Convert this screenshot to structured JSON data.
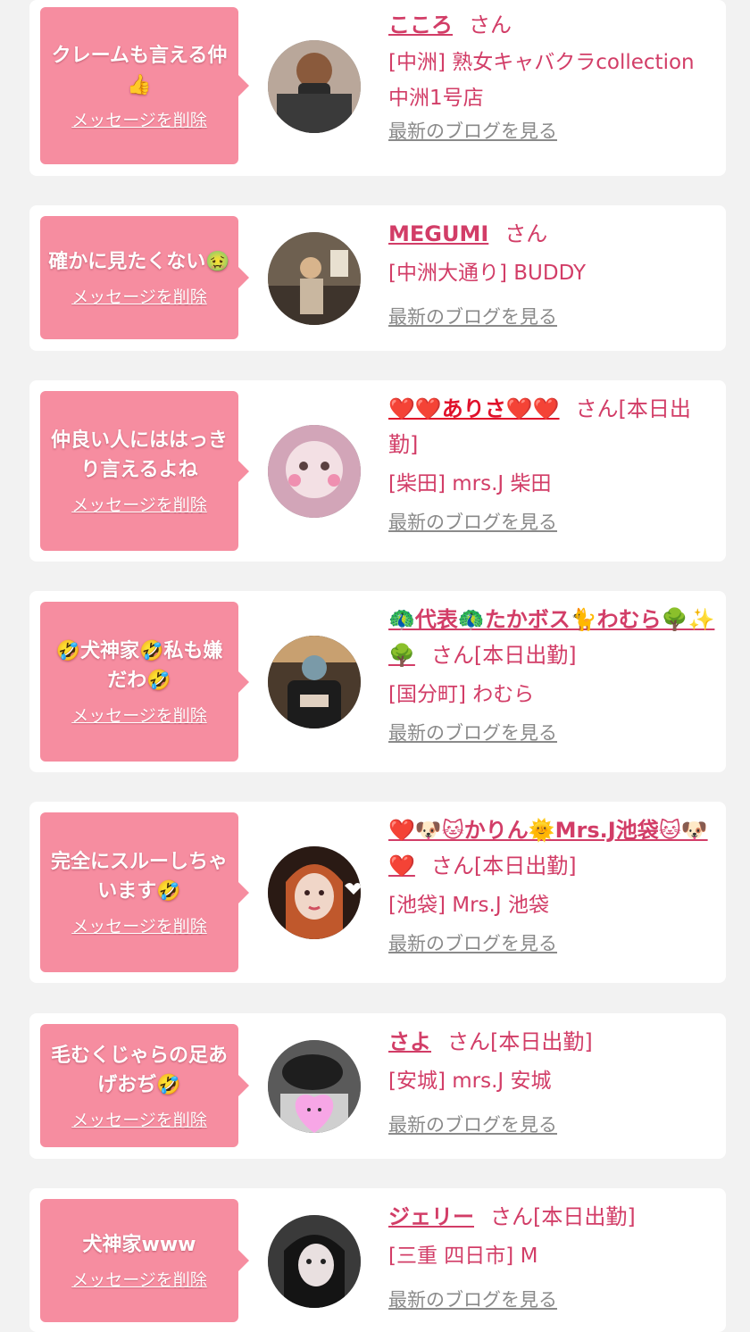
{
  "delete_label": "メッセージを削除",
  "blog_label": "最新のブログを見る",
  "san_label": "さん",
  "colors": {
    "bubble": "#f68da0",
    "name": "#d23d67",
    "blog": "#8a8a8a",
    "background": "#f2f2f2"
  },
  "cards": [
    {
      "message": "クレームも言える仲👍",
      "name": "こころ",
      "status": "",
      "shop": "[中洲] 熟女キャバクラcollection 中洲1号店"
    },
    {
      "message": "確かに見たくない🤢",
      "name": "MEGUMI",
      "status": "",
      "shop": "[中洲大通り] BUDDY"
    },
    {
      "message": "仲良い人にははっきり言えるよね",
      "name": "❤️❤️ありさ❤️❤️",
      "status": "[本日出勤]",
      "shop": "[柴田] mrs.J 柴田"
    },
    {
      "message": "🤣犬神家🤣私も嫌だわ🤣",
      "name": "🦚代表🦚たかボス🐈わむら🌳✨🌳",
      "status": "[本日出勤]",
      "shop": "[国分町] わむら"
    },
    {
      "message": "完全にスルーしちゃいます🤣",
      "name": "❤️🐶🐱かりん🌞Mrs.J池袋🐱🐶❤️",
      "status": "[本日出勤]",
      "shop": "[池袋] Mrs.J 池袋"
    },
    {
      "message": "毛むくじゃらの足あげおぢ🤣",
      "name": "さよ",
      "status": "[本日出勤]",
      "shop": "[安城] mrs.J 安城"
    },
    {
      "message": "犬神家www",
      "name": "ジェリー",
      "status": "[本日出勤]",
      "shop": "[三重 四日市] M"
    }
  ]
}
